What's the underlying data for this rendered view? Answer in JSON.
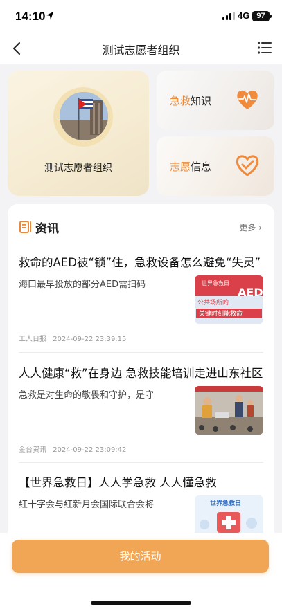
{
  "status_bar": {
    "time": "14:10",
    "network": "4G",
    "battery": "97"
  },
  "nav": {
    "title": "测试志愿者组织"
  },
  "cards": {
    "main_label": "测试志愿者组织",
    "first_aid": {
      "accent": "急救",
      "rest": "知识"
    },
    "volunteer": {
      "accent": "志愿",
      "rest": "信息"
    }
  },
  "news": {
    "title": "资讯",
    "more": "更多",
    "items": [
      {
        "title": "救命的AED被“锁”住，急救设备怎么避免“失灵”",
        "desc": "海口最早投放的部分AED需扫码",
        "source": "工人日报",
        "time": "2024-09-22 23:39:15",
        "thumb": {
          "line1": "世界急救日",
          "line2": "公共场所的",
          "line3": "关键时刻能救命",
          "badge": "AED"
        }
      },
      {
        "title": "人人健康“救”在身边 急救技能培训走进山东社区",
        "desc": "急救是对生命的敬畏和守护，是守",
        "source": "金台资讯",
        "time": "2024-09-22 23:09:42",
        "thumb": {}
      },
      {
        "title": "【世界急救日】人人学急救 人人懂急救",
        "desc": "红十字会与红新月会国际联合会将",
        "source": "",
        "time": "",
        "thumb": {
          "line1": "世界急救日"
        }
      }
    ]
  },
  "bottom": {
    "button": "我的活动"
  },
  "colors": {
    "accent": "#e8893b",
    "button": "#f0a655"
  }
}
